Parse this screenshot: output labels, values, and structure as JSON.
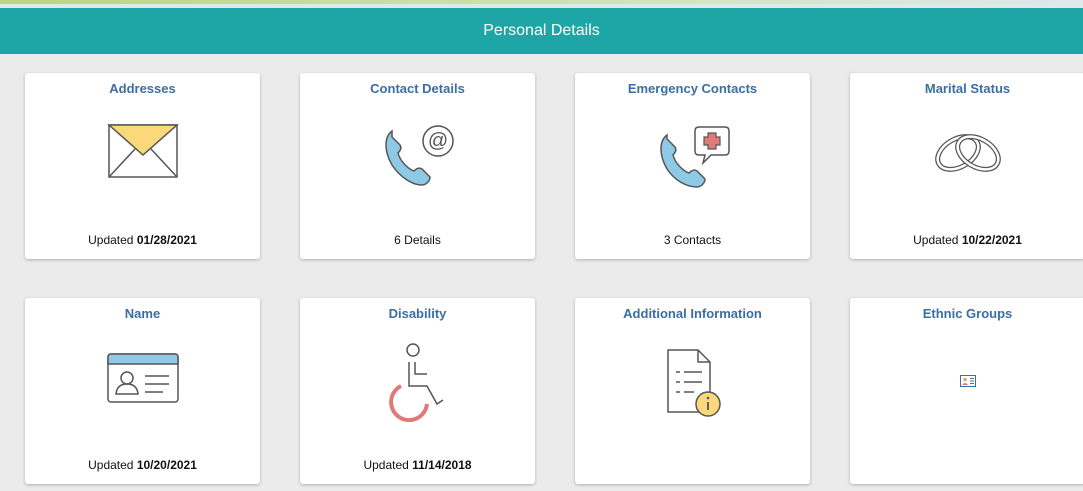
{
  "header": {
    "title": "Personal Details"
  },
  "tiles": [
    {
      "title": "Addresses",
      "icon": "envelope-icon",
      "footer_prefix": "Updated",
      "footer_value": "01/28/2021"
    },
    {
      "title": "Contact Details",
      "icon": "phone-at-icon",
      "footer_prefix": "",
      "footer_value": "6 Details"
    },
    {
      "title": "Emergency Contacts",
      "icon": "phone-medical-icon",
      "footer_prefix": "",
      "footer_value": "3 Contacts"
    },
    {
      "title": "Marital Status",
      "icon": "rings-icon",
      "footer_prefix": "Updated",
      "footer_value": "10/22/2021"
    },
    {
      "title": "Name",
      "icon": "id-card-icon",
      "footer_prefix": "Updated",
      "footer_value": "10/20/2021"
    },
    {
      "title": "Disability",
      "icon": "wheelchair-icon",
      "footer_prefix": "Updated",
      "footer_value": "11/14/2018"
    },
    {
      "title": "Additional Information",
      "icon": "document-info-icon",
      "footer_prefix": "",
      "footer_value": ""
    },
    {
      "title": "Ethnic Groups",
      "icon": "small-id-card-icon",
      "footer_prefix": "",
      "footer_value": ""
    }
  ],
  "colors": {
    "header_bg": "#1ea6a6",
    "title_text": "#3a6ea5",
    "icon_blue": "#8ecae6",
    "icon_yellow": "#fbd97a",
    "icon_red": "#e07a7a"
  }
}
